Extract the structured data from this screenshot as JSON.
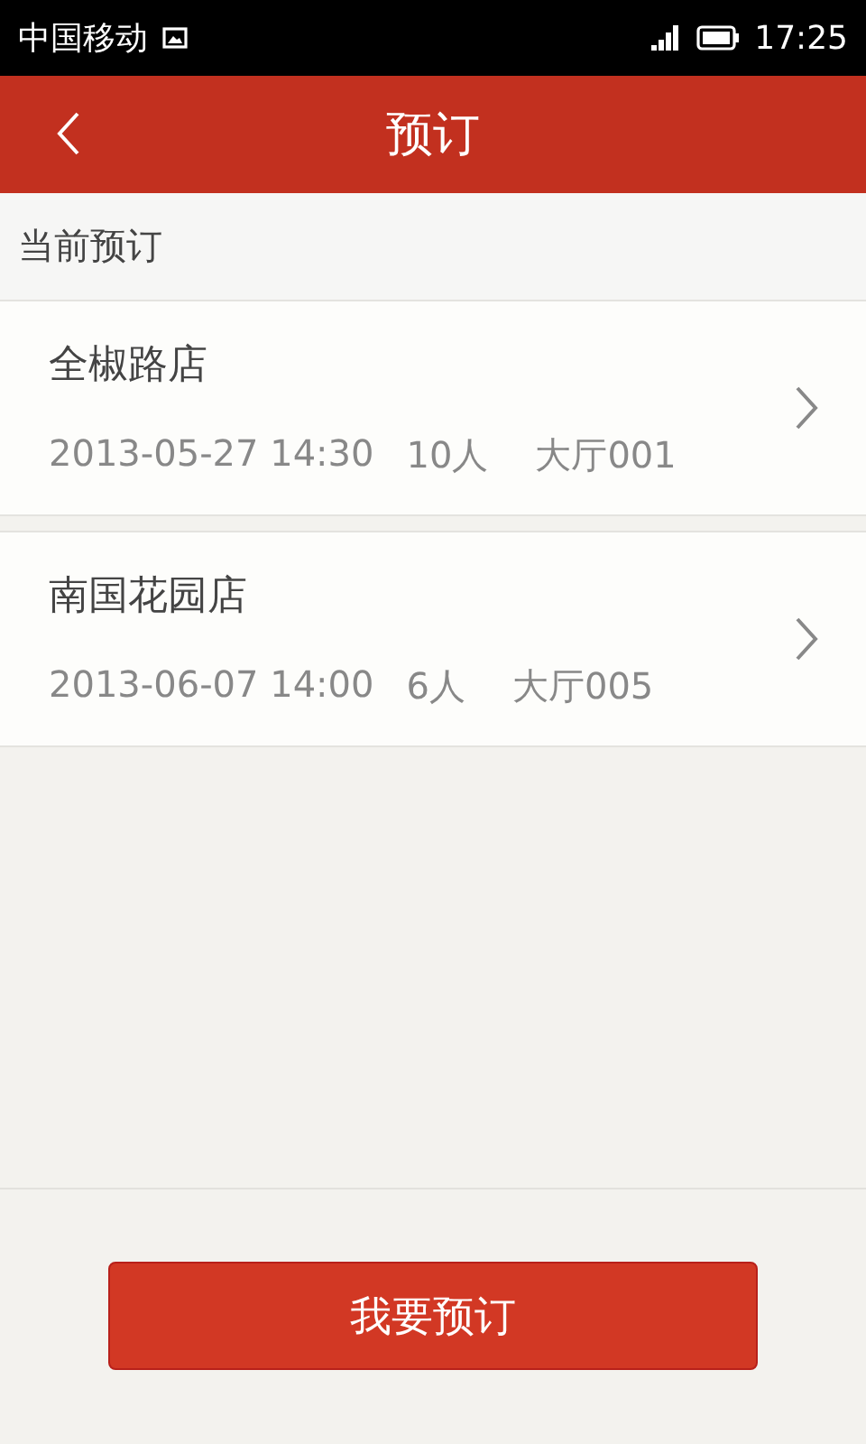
{
  "status_bar": {
    "carrier": "中国移动",
    "time": "17:25"
  },
  "header": {
    "title": "预订"
  },
  "section": {
    "label": "当前预订"
  },
  "reservations": [
    {
      "store": "全椒路店",
      "datetime": "2013-05-27 14:30",
      "people": "10人",
      "table": "大厅001"
    },
    {
      "store": "南国花园店",
      "datetime": "2013-06-07 14:00",
      "people": "6人",
      "table": "大厅005"
    }
  ],
  "action_button": {
    "label": "我要预订"
  }
}
